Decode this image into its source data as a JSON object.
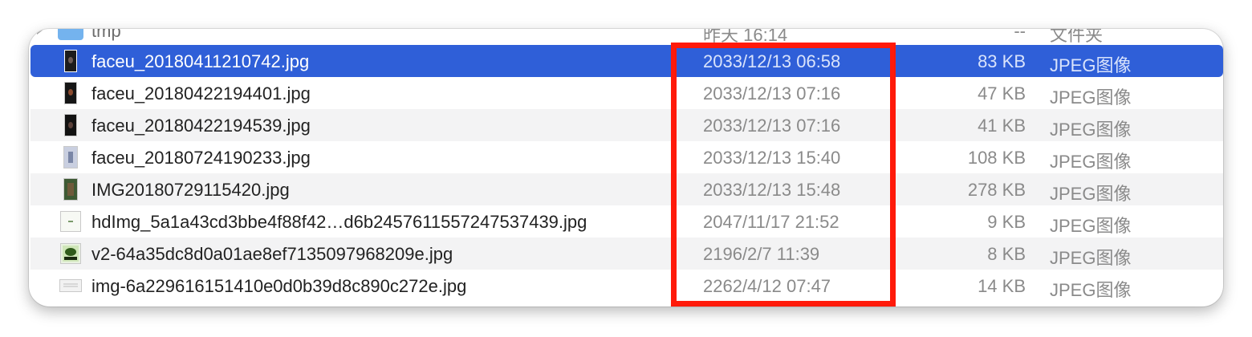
{
  "rows": [
    {
      "name": "tmp",
      "date": "昨天 16:14",
      "size": "--",
      "kind": "文件夹",
      "icon": "folder-icon"
    },
    {
      "name": "faceu_20180411210742.jpg",
      "date": "2033/12/13 06:58",
      "size": "83 KB",
      "kind": "JPEG图像",
      "icon": "dark-photo-thumbnail-icon",
      "selected": true
    },
    {
      "name": "faceu_20180422194401.jpg",
      "date": "2033/12/13 07:16",
      "size": "47 KB",
      "kind": "JPEG图像",
      "icon": "dark-photo-thumbnail-icon"
    },
    {
      "name": "faceu_20180422194539.jpg",
      "date": "2033/12/13 07:16",
      "size": "41 KB",
      "kind": "JPEG图像",
      "icon": "dark-photo-thumbnail-icon"
    },
    {
      "name": "faceu_20180724190233.jpg",
      "date": "2033/12/13 15:40",
      "size": "108 KB",
      "kind": "JPEG图像",
      "icon": "light-photo-thumbnail-icon"
    },
    {
      "name": "IMG20180729115420.jpg",
      "date": "2033/12/13 15:48",
      "size": "278 KB",
      "kind": "JPEG图像",
      "icon": "green-photo-thumbnail-icon"
    },
    {
      "name": "hdImg_5a1a43cd3bbe4f88f42…d6b2457611557247537439.jpg",
      "date": "2047/11/17 21:52",
      "size": "9 KB",
      "kind": "JPEG图像",
      "icon": "small-image-thumbnail-icon"
    },
    {
      "name": "v2-64a35dc8d0a01ae8ef7135097968209e.jpg",
      "date": "2196/2/7 11:39",
      "size": "8 KB",
      "kind": "JPEG图像",
      "icon": "graphic-thumbnail-icon"
    },
    {
      "name": "img-6a229616151410e0d0b39d8c890c272e.jpg",
      "date": "2262/4/12 07:47",
      "size": "14 KB",
      "kind": "JPEG图像",
      "icon": "wide-image-thumbnail-icon"
    }
  ],
  "colors": {
    "selection": "#2f5fd8",
    "stripe": "#f3f3f4",
    "annotation_box": "#ff1a0a"
  }
}
